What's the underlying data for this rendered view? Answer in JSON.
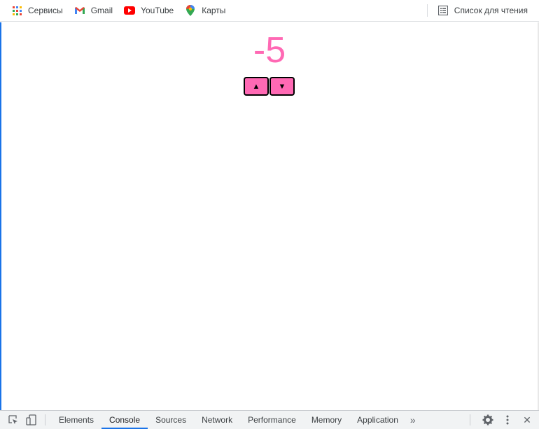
{
  "bookmarks": [
    {
      "label": "Сервисы",
      "icon": "apps-grid-icon"
    },
    {
      "label": "Gmail",
      "icon": "gmail-icon"
    },
    {
      "label": "YouTube",
      "icon": "youtube-icon"
    },
    {
      "label": "Карты",
      "icon": "maps-pin-icon"
    }
  ],
  "reading_list": {
    "label": "Список для чтения",
    "icon": "reading-list-icon"
  },
  "counter": {
    "value": "-5",
    "color": "#ff69b4"
  },
  "buttons": {
    "up": "▲",
    "down": "▼"
  },
  "devtools": {
    "tabs": [
      "Elements",
      "Console",
      "Sources",
      "Network",
      "Performance",
      "Memory",
      "Application"
    ],
    "active_tab": "Console",
    "more": "»",
    "close": "✕"
  }
}
